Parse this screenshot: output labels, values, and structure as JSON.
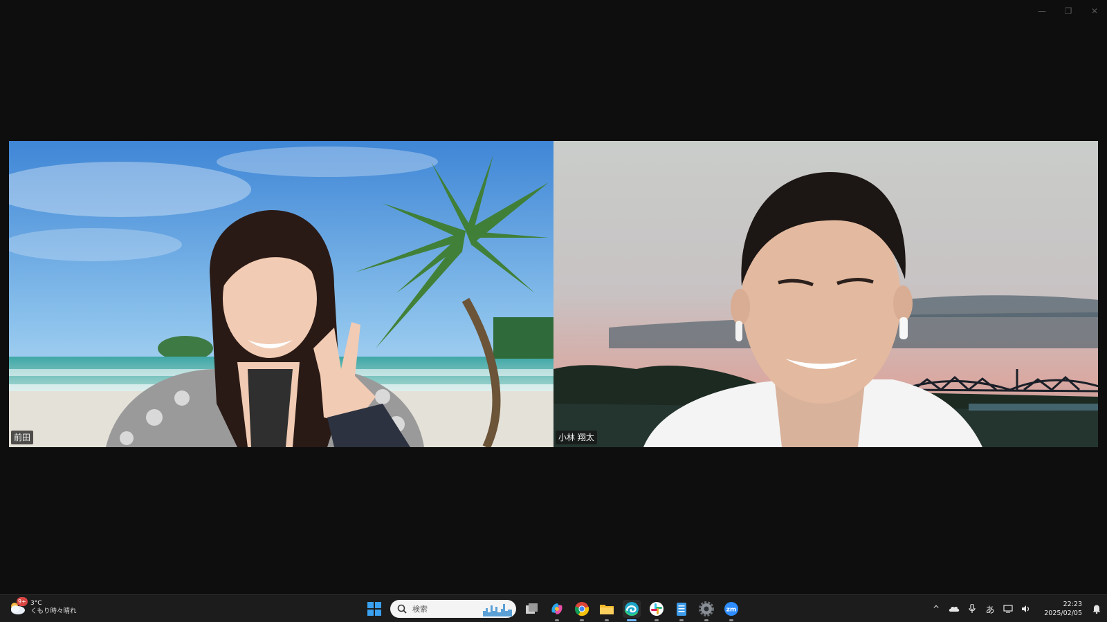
{
  "window": {
    "minimize_glyph": "—",
    "restore_glyph": "❐",
    "close_glyph": "✕"
  },
  "participants": [
    {
      "name": "前田",
      "background": "beach-palm-tree"
    },
    {
      "name": "小林 翔太",
      "background": "sunset-river-bridge"
    }
  ],
  "taskbar": {
    "weather": {
      "badge": "9+",
      "temperature": "3°C",
      "condition": "くもり時々晴れ",
      "icon": "cloud-sun-icon"
    },
    "search": {
      "placeholder": "検索"
    },
    "apps": [
      {
        "name": "start-button",
        "icon": "windows-icon"
      },
      {
        "name": "task-view",
        "icon": "task-view-icon"
      },
      {
        "name": "copilot",
        "icon": "copilot-icon"
      },
      {
        "name": "chrome",
        "icon": "chrome-icon"
      },
      {
        "name": "file-explorer",
        "icon": "folder-icon"
      },
      {
        "name": "edge",
        "icon": "edge-icon",
        "active": true
      },
      {
        "name": "slack",
        "icon": "slack-icon"
      },
      {
        "name": "notepad",
        "icon": "notepad-icon"
      },
      {
        "name": "settings",
        "icon": "gear-icon"
      },
      {
        "name": "zoom",
        "icon": "zoom-icon",
        "label": "zm"
      }
    ],
    "tray": {
      "chevron": "^",
      "ime": "あ",
      "time": "22:23",
      "date": "2025/02/05"
    },
    "colors": {
      "zoom_blue": "#2d8cff",
      "windows_blue": "#3aa0f0",
      "edge_teal": "#1fa7c8"
    }
  }
}
